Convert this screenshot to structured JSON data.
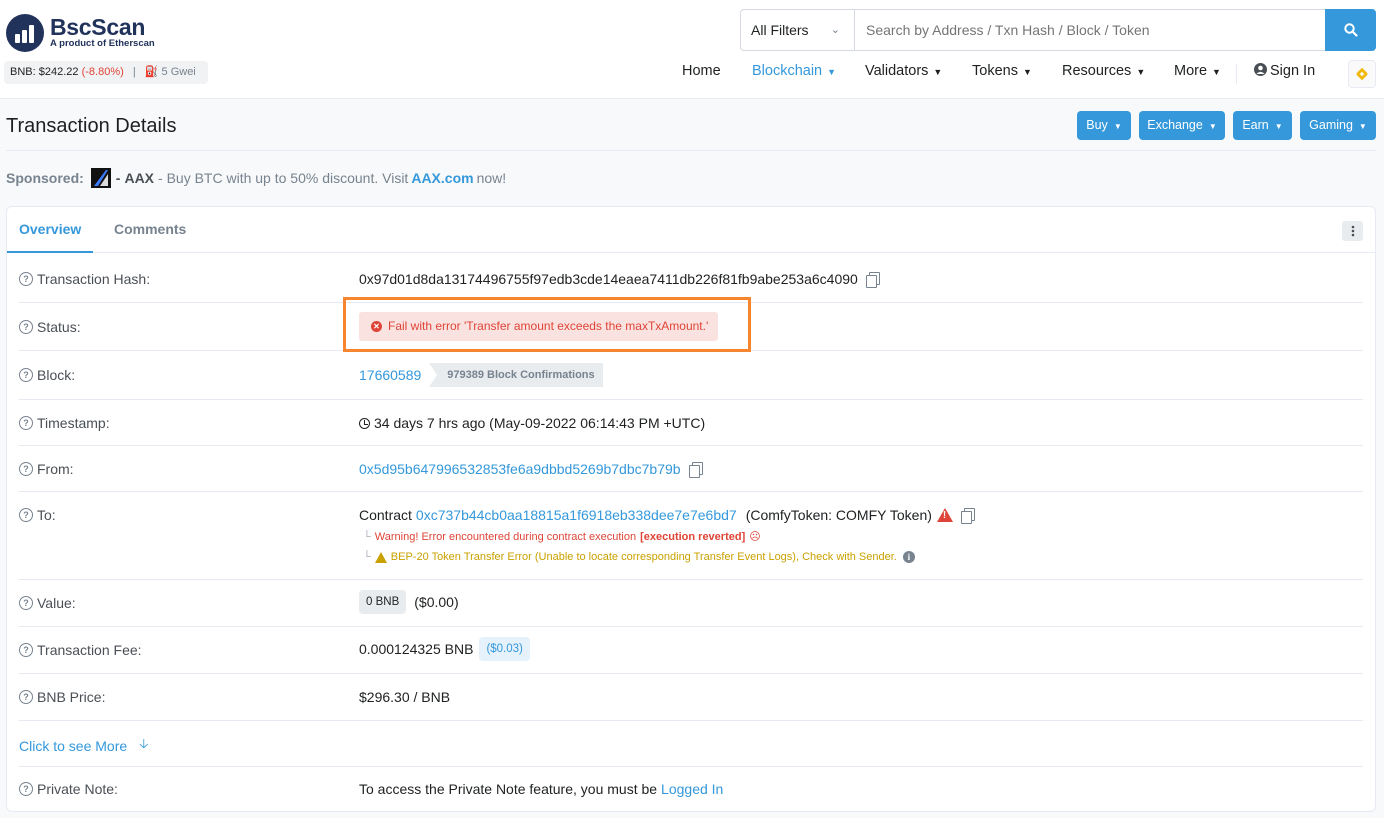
{
  "brand": {
    "name": "BscScan",
    "tagline": "A product of Etherscan"
  },
  "ticker": {
    "price_label": "BNB:",
    "price": "$242.22",
    "change": "(-8.80%)",
    "separator": "|",
    "gas": "5 Gwei"
  },
  "search": {
    "filter_label": "All Filters",
    "placeholder": "Search by Address / Txn Hash / Block / Token"
  },
  "nav": {
    "home": "Home",
    "blockchain": "Blockchain",
    "validators": "Validators",
    "tokens": "Tokens",
    "resources": "Resources",
    "more": "More",
    "sign_in": "Sign In"
  },
  "page": {
    "title": "Transaction Details"
  },
  "actions": {
    "buy": "Buy",
    "exchange": "Exchange",
    "earn": "Earn",
    "gaming": "Gaming"
  },
  "sponsored": {
    "label": "Sponsored:",
    "brand": "AAX",
    "dash": "-",
    "text": "- Buy BTC with up to 50% discount. Visit",
    "link": "AAX.com",
    "suffix": "now!"
  },
  "tabs": {
    "overview": "Overview",
    "comments": "Comments"
  },
  "details": {
    "tx_hash_label": "Transaction Hash:",
    "tx_hash": "0x97d01d8da13174496755f97edb3cde14eaea7411db226f81fb9abe253a6c4090",
    "status_label": "Status:",
    "status": "Fail with error 'Transfer amount exceeds the maxTxAmount.'",
    "block_label": "Block:",
    "block": "17660589",
    "block_confirmations": "979389 Block Confirmations",
    "timestamp_label": "Timestamp:",
    "timestamp": "34 days 7 hrs ago (May-09-2022 06:14:43 PM +UTC)",
    "from_label": "From:",
    "from": "0x5d95b647996532853fe6a9dbbd5269b7dbc7b79b",
    "to_label": "To:",
    "to_prefix": "Contract",
    "to_address": "0xc737b44cb0aa18815a1f6918eb338dee7e7e6bd7",
    "to_name": "(ComfyToken: COMFY Token)",
    "warning_text": "Warning! Error encountered during contract execution",
    "warning_reason": "[execution reverted]",
    "transfer_error": "BEP-20 Token Transfer Error (Unable to locate corresponding Transfer Event Logs), Check with Sender.",
    "value_label": "Value:",
    "value_amount": "0 BNB",
    "value_usd": "($0.00)",
    "fee_label": "Transaction Fee:",
    "fee": "0.000124325 BNB",
    "fee_usd": "($0.03)",
    "price_label": "BNB Price:",
    "price": "$296.30 / BNB",
    "see_more": "Click to see More",
    "note_label": "Private Note:",
    "note_text": "To access the Private Note feature, you must be",
    "note_link": "Logged In"
  },
  "colors": {
    "accent": "#3498db",
    "error": "#de4437",
    "warning": "#c9a100",
    "highlight_box": "#f7852e"
  }
}
